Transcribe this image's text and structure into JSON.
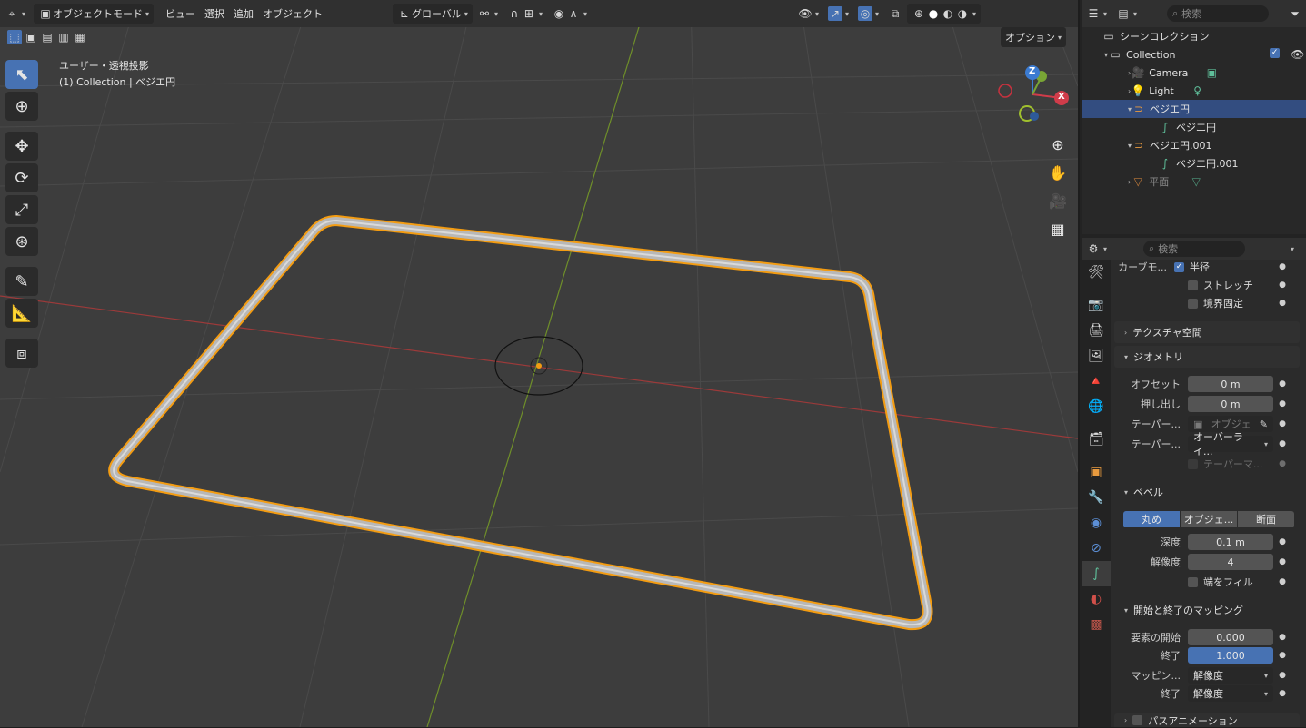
{
  "header": {
    "mode": "オブジェクトモード",
    "menu": [
      "ビュー",
      "選択",
      "追加",
      "オブジェクト"
    ],
    "orientation": "グローバル",
    "options": "オプション"
  },
  "overlay": {
    "view_name": "ユーザー・透視投影",
    "collection_label": "(1) Collection | ベジエ円"
  },
  "gizmo": {
    "z": "Z",
    "x": "X"
  },
  "outliner": {
    "search_placeholder": "検索",
    "scene_collection": "シーンコレクション",
    "items": [
      {
        "label": "Collection"
      },
      {
        "label": "Camera"
      },
      {
        "label": "Light"
      },
      {
        "label": "ベジエ円"
      },
      {
        "label": "ベジエ円"
      },
      {
        "label": "ベジエ円.001"
      },
      {
        "label": "ベジエ円.001"
      },
      {
        "label": "平面"
      }
    ]
  },
  "properties": {
    "search_placeholder": "検索",
    "curve_mode_label": "カーブモ...",
    "radius": "半径",
    "stretch": "ストレッチ",
    "bounds_clamp": "境界固定",
    "texture_space": "テクスチャ空間",
    "geometry": "ジオメトリ",
    "offset_label": "オフセット",
    "offset_value": "0 m",
    "extrude_label": "押し出し",
    "extrude_value": "0 m",
    "taper_label": "テーパー...",
    "taper_object_placeholder": "オブジェ",
    "taper_mode_label": "テーパー...",
    "taper_mode_value": "オーバーライ...",
    "taper_map": "テーパーマ...",
    "bevel": "ベベル",
    "bevel_tabs": [
      "丸め",
      "オブジェ...",
      "断面"
    ],
    "depth_label": "深度",
    "depth_value": "0.1 m",
    "resolution_label": "解像度",
    "resolution_value": "4",
    "fill_caps": "端をフィル",
    "mapping_section": "開始と終了のマッピング",
    "start_label": "要素の開始",
    "start_value": "0.000",
    "end_label": "終了",
    "end_value": "1.000",
    "mapping_label": "マッピン...",
    "mapping_value": "解像度",
    "end2_label": "終了",
    "end2_value": "解像度",
    "path_anim": "パスアニメーション"
  },
  "colors": {
    "accent": "#4772b3",
    "selection": "#f5a623",
    "x_axis": "#c03a3a",
    "y_axis": "#7a9b2e"
  }
}
